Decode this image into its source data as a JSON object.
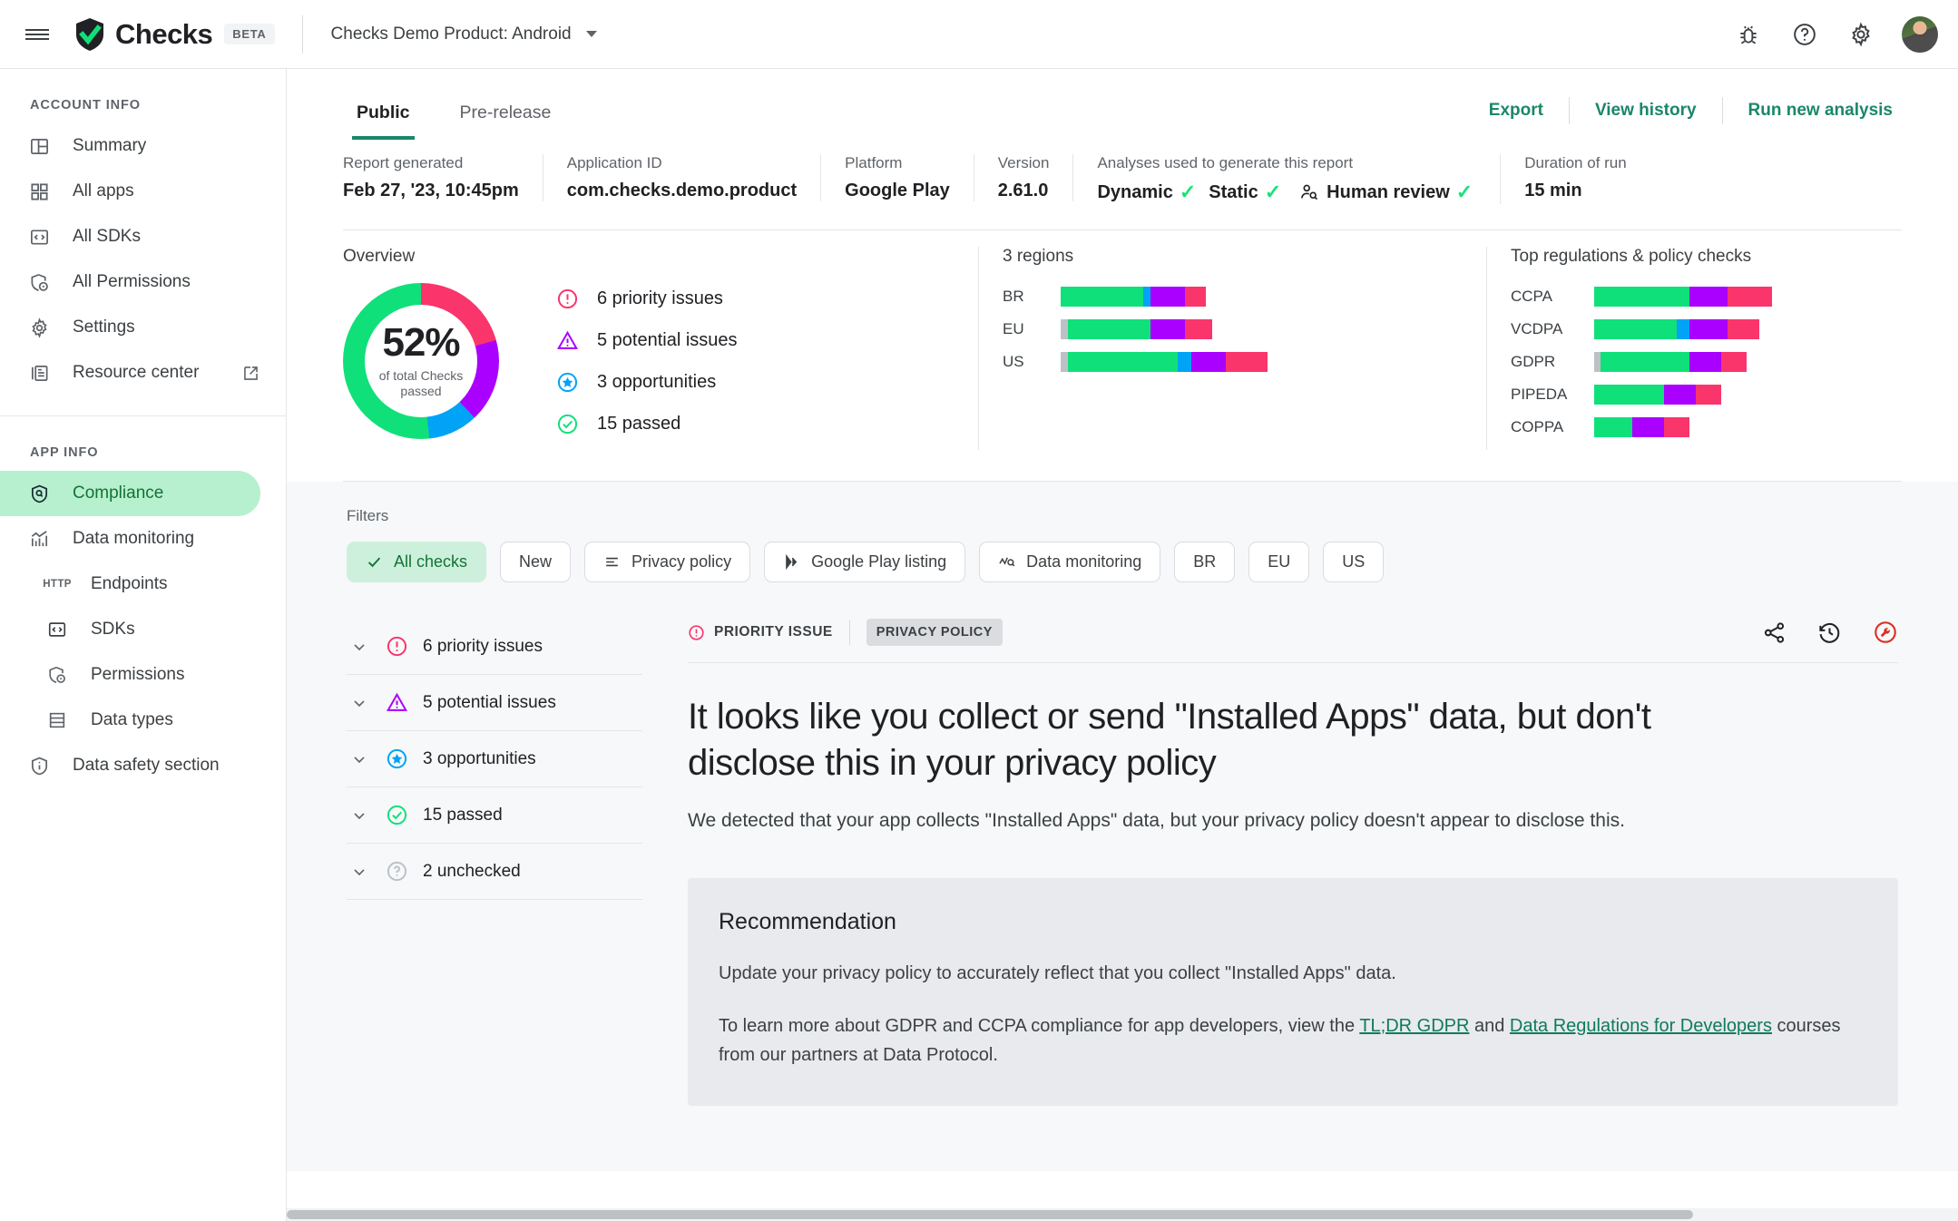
{
  "topbar": {
    "menu_icon": "hamburger-icon",
    "brand_name": "Checks",
    "beta_label": "BETA",
    "product_name": "Checks Demo Product: Android",
    "icons": [
      "bug-icon",
      "help-icon",
      "gear-icon",
      "avatar"
    ]
  },
  "sidebar": {
    "account_section": "ACCOUNT INFO",
    "app_section": "APP INFO",
    "account_items": [
      {
        "label": "Summary",
        "icon": "summary-icon"
      },
      {
        "label": "All apps",
        "icon": "apps-grid-icon"
      },
      {
        "label": "All SDKs",
        "icon": "code-brackets-icon"
      },
      {
        "label": "All Permissions",
        "icon": "shield-permission-icon"
      },
      {
        "label": "Settings",
        "icon": "gear-icon"
      },
      {
        "label": "Resource center",
        "icon": "resource-book-icon",
        "external": true
      }
    ],
    "app_items": [
      {
        "label": "Compliance",
        "icon": "shield-compliance-icon",
        "active": true
      },
      {
        "label": "Data monitoring",
        "icon": "chart-monitor-icon"
      },
      {
        "label": "Endpoints",
        "icon": "http-icon"
      },
      {
        "label": "SDKs",
        "icon": "code-brackets-icon"
      },
      {
        "label": "Permissions",
        "icon": "shield-permission-icon"
      },
      {
        "label": "Data types",
        "icon": "data-types-icon"
      },
      {
        "label": "Data safety section",
        "icon": "info-shield-icon"
      }
    ]
  },
  "content": {
    "tabs": [
      {
        "label": "Public",
        "active": true
      },
      {
        "label": "Pre-release",
        "active": false
      }
    ],
    "actions": [
      "Export",
      "View history",
      "Run new analysis"
    ],
    "meta": [
      {
        "label": "Report generated",
        "value": "Feb 27, '23, 10:45pm"
      },
      {
        "label": "Application ID",
        "value": "com.checks.demo.product"
      },
      {
        "label": "Platform",
        "value": "Google Play"
      },
      {
        "label": "Version",
        "value": "2.61.0"
      },
      {
        "label": "Analyses used to generate this report",
        "value": "Dynamic ✓ Static ✓ Human review ✓",
        "analyses": [
          {
            "name": "Dynamic",
            "checked": true
          },
          {
            "name": "Static",
            "checked": true
          },
          {
            "name": "Human review",
            "checked": true,
            "icon": "person-search-icon"
          }
        ]
      },
      {
        "label": "Duration of run",
        "value": "15 min"
      }
    ]
  },
  "chart_data": [
    {
      "type": "pie",
      "title": "Overview",
      "center_value": "52%",
      "center_label": "of total Checks passed",
      "categories": [
        "6 priority issues",
        "5 potential issues",
        "3 opportunities",
        "15 passed"
      ],
      "values": [
        6,
        5,
        3,
        15
      ],
      "colors": [
        "#f9356c",
        "#aa00ff",
        "#00a3f5",
        "#10e07a"
      ],
      "legend": [
        {
          "label": "6 priority issues",
          "icon": "priority-issue-icon",
          "color": "#f9356c"
        },
        {
          "label": "5 potential issues",
          "icon": "potential-issue-icon",
          "color": "#aa00ff"
        },
        {
          "label": "3 opportunities",
          "icon": "opportunity-star-icon",
          "color": "#00a3f5"
        },
        {
          "label": "15 passed",
          "icon": "passed-check-icon",
          "color": "#10e07a"
        }
      ],
      "legend_position": "right"
    },
    {
      "type": "bar",
      "title": "3 regions",
      "orientation": "horizontal",
      "stacked": true,
      "categories": [
        "BR",
        "EU",
        "US"
      ],
      "series": [
        {
          "name": "unchecked",
          "color": "#bdc1c6",
          "values": [
            0,
            1,
            1
          ]
        },
        {
          "name": "passed",
          "color": "#10e07a",
          "values": [
            12,
            12,
            16
          ]
        },
        {
          "name": "opportunities",
          "color": "#00a3f5",
          "values": [
            1,
            0,
            2
          ]
        },
        {
          "name": "potential issues",
          "color": "#aa00ff",
          "values": [
            5,
            5,
            5
          ]
        },
        {
          "name": "priority issues",
          "color": "#f9356c",
          "values": [
            3,
            4,
            6
          ]
        }
      ]
    },
    {
      "type": "bar",
      "title": "Top regulations & policy checks",
      "orientation": "horizontal",
      "stacked": true,
      "categories": [
        "CCPA",
        "VCDPA",
        "GDPR",
        "PIPEDA",
        "COPPA"
      ],
      "series": [
        {
          "name": "unchecked",
          "color": "#bdc1c6",
          "values": [
            0,
            0,
            1,
            0,
            0
          ]
        },
        {
          "name": "passed",
          "color": "#10e07a",
          "values": [
            15,
            13,
            14,
            11,
            6
          ]
        },
        {
          "name": "opportunities",
          "color": "#00a3f5",
          "values": [
            0,
            2,
            0,
            0,
            0
          ]
        },
        {
          "name": "potential issues",
          "color": "#aa00ff",
          "values": [
            6,
            6,
            5,
            5,
            5
          ]
        },
        {
          "name": "priority issues",
          "color": "#f9356c",
          "values": [
            7,
            5,
            4,
            4,
            4
          ]
        }
      ]
    }
  ],
  "filters": {
    "label": "Filters",
    "chips": [
      {
        "label": "All checks",
        "icon": "check-icon",
        "selected": true
      },
      {
        "label": "New",
        "icon": null,
        "selected": false
      },
      {
        "label": "Privacy policy",
        "icon": "policy-lines-icon",
        "selected": false
      },
      {
        "label": "Google Play listing",
        "icon": "play-listing-icon",
        "selected": false
      },
      {
        "label": "Data monitoring",
        "icon": "data-monitoring-icon",
        "selected": false
      },
      {
        "label": "BR",
        "icon": null,
        "selected": false
      },
      {
        "label": "EU",
        "icon": null,
        "selected": false
      },
      {
        "label": "US",
        "icon": null,
        "selected": false
      }
    ]
  },
  "issue_groups": [
    {
      "label": "6 priority issues",
      "icon": "priority-issue-icon",
      "color": "#f9356c"
    },
    {
      "label": "5 potential issues",
      "icon": "potential-issue-icon",
      "color": "#aa00ff"
    },
    {
      "label": "3 opportunities",
      "icon": "opportunity-star-icon",
      "color": "#00a3f5"
    },
    {
      "label": "15 passed",
      "icon": "passed-check-icon",
      "color": "#10e07a"
    },
    {
      "label": "2 unchecked",
      "icon": "unchecked-icon",
      "color": "#bdc1c6"
    }
  ],
  "detail": {
    "badge_priority": "PRIORITY ISSUE",
    "tag_policy": "PRIVACY POLICY",
    "actions": [
      {
        "name": "share-icon"
      },
      {
        "name": "history-icon"
      },
      {
        "name": "fix-wrench-icon"
      }
    ],
    "title": "It looks like you collect or send \"Installed Apps\" data, but don't disclose this in your privacy policy",
    "description": "We detected that your app collects \"Installed Apps\" data, but your privacy policy doesn't appear to disclose this.",
    "recommendation": {
      "heading": "Recommendation",
      "paragraph1": "Update your privacy policy to accurately reflect that you collect \"Installed Apps\" data.",
      "p2_pre": "To learn more about GDPR and CCPA compliance for app developers, view the ",
      "link1": "TL;DR GDPR",
      "p2_mid": " and ",
      "link2": "Data Regulations for Developers",
      "p2_post": " courses from our partners at Data Protocol."
    }
  },
  "colors": {
    "brand_green": "#10e07a",
    "accent_teal": "#1a8769",
    "priority": "#f9356c",
    "potential": "#aa00ff",
    "opportunity": "#00a3f5",
    "passed": "#10e07a",
    "unchecked": "#bdc1c6"
  }
}
